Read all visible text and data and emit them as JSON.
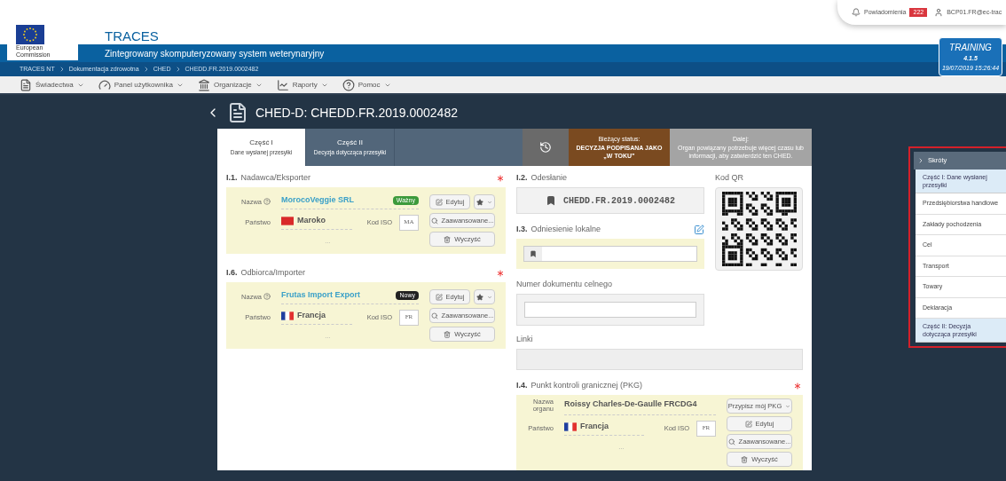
{
  "header": {
    "logo_caption": "European Commission",
    "app_title": "TRACES",
    "subtitle": "Zintegrowany skomputeryzowany system weterynaryjny",
    "notifications": {
      "label": "Powiadomienia",
      "count": "222"
    },
    "user": "BCP01.FR@ec-trac",
    "environment": {
      "name": "TRAINING",
      "version": "4.1.5",
      "timestamp": "19/07/2019 15:26:44"
    }
  },
  "breadcrumb": [
    "TRACES NT",
    "Dokumentacja zdrowotna",
    "CHED",
    "CHEDD.FR.2019.0002482"
  ],
  "menu": [
    {
      "kind": "document",
      "label": "Świadectwa"
    },
    {
      "kind": "dashboard",
      "label": "Panel użytkownika"
    },
    {
      "kind": "building",
      "label": "Organizacje"
    },
    {
      "kind": "chart",
      "label": "Raporty"
    },
    {
      "kind": "help",
      "label": "Pomoc"
    }
  ],
  "page_title": "CHED-D: CHEDD.FR.2019.0002482",
  "tabs": [
    {
      "title": "Część I",
      "subtitle": "Dane wysłanej przesyłki",
      "selected": true
    },
    {
      "title": "Część II",
      "subtitle": "Decyzja dotycząca przesyłki",
      "selected": false
    }
  ],
  "status": {
    "label": "Bieżący status:",
    "value": "DECYZJA PODPISANA JAKO „W TOKU”"
  },
  "next": {
    "label": "Dalej:",
    "text": "Organ powiązany potrzebuje więcej czasu lub informacji, aby zatwierdzić ten CHED."
  },
  "left_sections": [
    {
      "number": "I.1.",
      "title": "Nadawca/Eksporter",
      "required": true,
      "name_label": "Nazwa",
      "name": "MorocoVeggie SRL",
      "badge": {
        "label": "Ważny",
        "color": "#3c9a3c"
      },
      "country_label": "Państwo",
      "country": {
        "kind": "morocco",
        "name": "Maroko"
      },
      "iso_label": "Kod ISO",
      "iso": "MA",
      "more": "...",
      "buttons": [
        "Edytuj",
        "Zaawansowane...",
        "Wyczyść"
      ]
    },
    {
      "number": "I.6.",
      "title": "Odbiorca/Importer",
      "required": true,
      "name_label": "Nazwa",
      "name": "Frutas Import Export",
      "badge": {
        "label": "Nowy",
        "color": "#222222"
      },
      "country_label": "Państwo",
      "country": {
        "kind": "france",
        "name": "Francja"
      },
      "iso_label": "Kod ISO",
      "iso": "FR",
      "more": "...",
      "buttons": [
        "Edytuj",
        "Zaawansowane...",
        "Wyczyść"
      ]
    }
  ],
  "reference": {
    "number": "I.2.",
    "title": "Odesłanie",
    "value": "CHEDD.FR.2019.0002482"
  },
  "qr": {
    "title": "Kod QR"
  },
  "local_reference": {
    "number": "I.3.",
    "title": "Odniesienie lokalne"
  },
  "customs": {
    "title": "Numer dokumentu celnego"
  },
  "links": {
    "title": "Linki"
  },
  "bip": {
    "number": "I.4.",
    "title": "Punkt kontroli granicznej (PKG)",
    "required": true,
    "name_label": "Nazwa organu",
    "name": "Roissy Charles-De-Gaulle FRCDG4",
    "country_label": "Państwo",
    "country": {
      "kind": "france",
      "name": "Francja"
    },
    "iso_label": "Kod ISO",
    "iso": "FR",
    "more": "...",
    "buttons": [
      "Przypisz mój PKG",
      "Edytuj",
      "Zaawansowane...",
      "Wyczyść"
    ]
  },
  "shortcuts": {
    "title": "Skróty",
    "items": [
      {
        "label": "Część I: Dane wysłanej przesyłki",
        "kind": "part"
      },
      {
        "label": "Przedsiębiorstwa handlowe",
        "kind": "link"
      },
      {
        "label": "Zakłady pochodzenia",
        "kind": "link"
      },
      {
        "label": "Cel",
        "kind": "link"
      },
      {
        "label": "Transport",
        "kind": "link"
      },
      {
        "label": "Towary",
        "kind": "link"
      },
      {
        "label": "Deklaracja",
        "kind": "link"
      },
      {
        "label": "Część II: Decyzja dotycząca przesyłki",
        "kind": "part"
      }
    ]
  }
}
